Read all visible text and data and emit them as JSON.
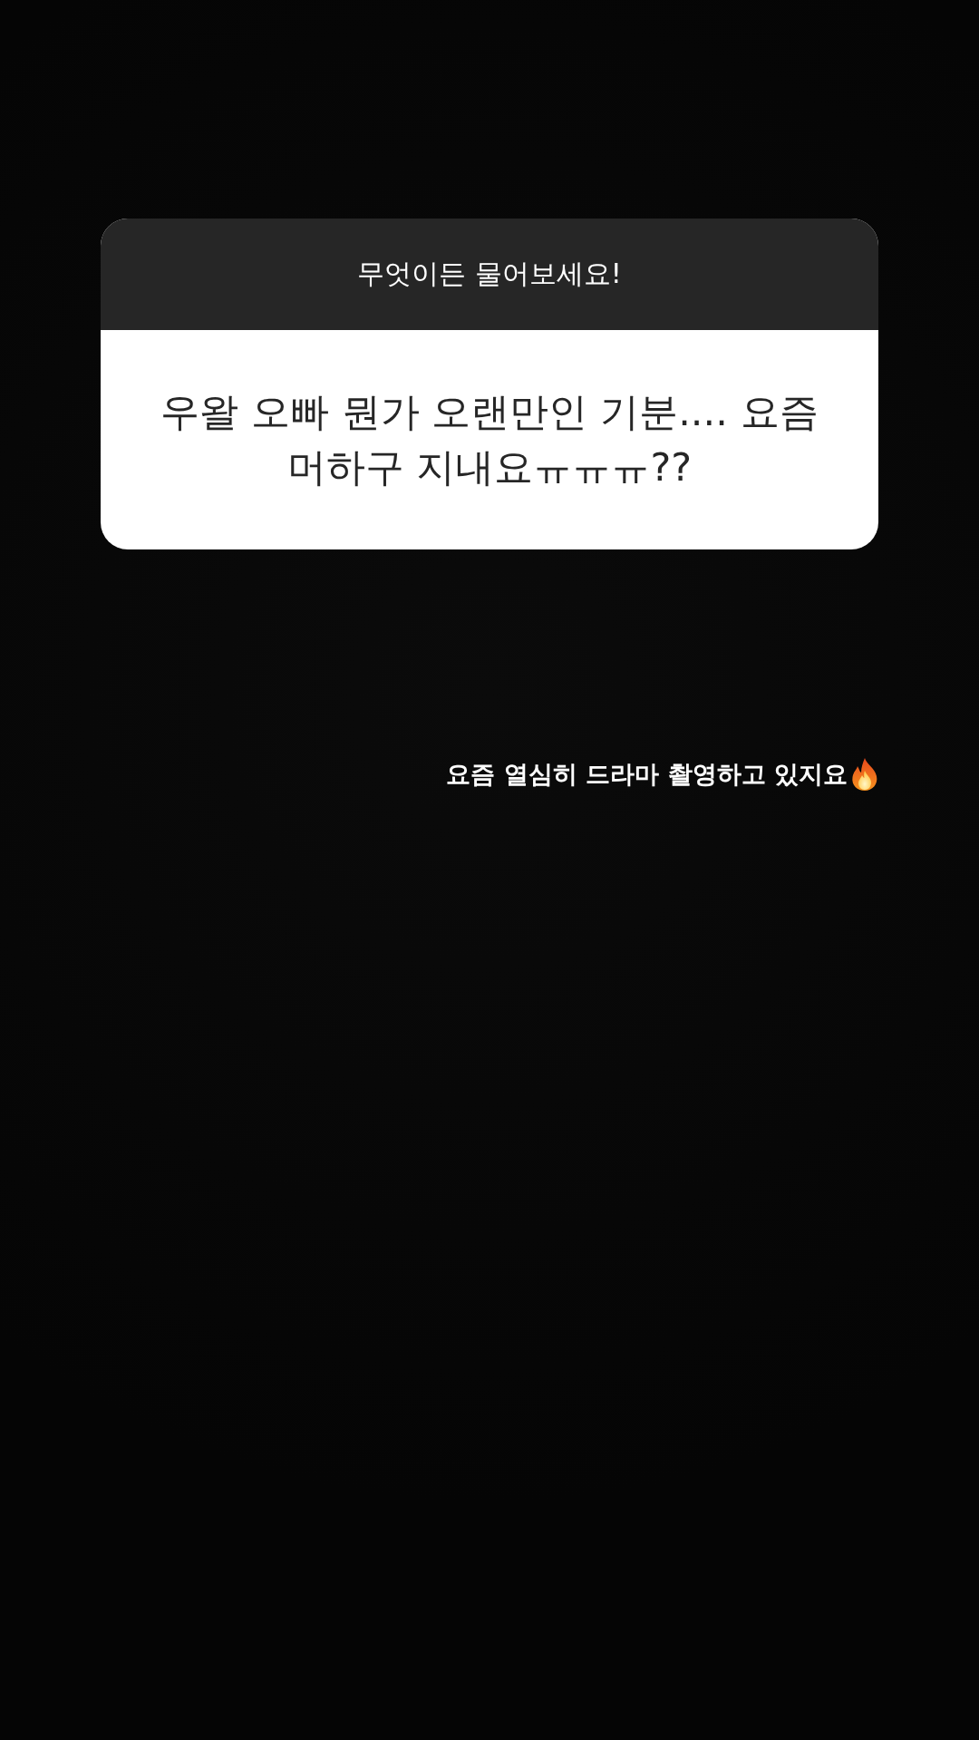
{
  "question_card": {
    "prompt": "무엇이든 물어보세요!",
    "question": "우왈 오빠 뭔가 오랜만인 기분.... 요즘 머하구 지내요ㅠㅠㅠ??"
  },
  "reply": {
    "text": "요즘 열심히 드라마 촬영하고 있지요"
  }
}
